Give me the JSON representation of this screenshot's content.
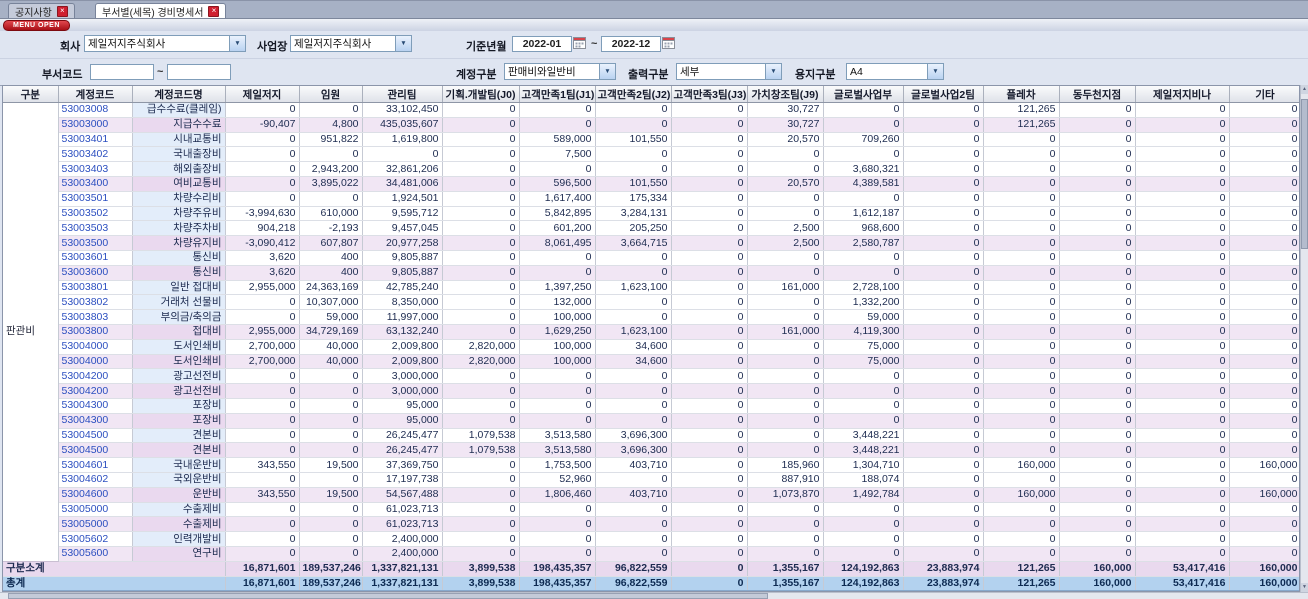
{
  "tabs": [
    {
      "label": "공지사항",
      "active": false
    },
    {
      "label": "부서별(세목) 경비명세서",
      "active": true
    }
  ],
  "menu_open_label": "MENU OPEN",
  "filters": {
    "company_label": "회사",
    "company_value": "제일저지주식회사",
    "worksite_label": "사업장",
    "worksite_value": "제일저지주식회사",
    "base_month_label": "기준년월",
    "date_from": "2022-01",
    "date_to": "2022-12",
    "tilde": "~",
    "dept_code_label": "부서코드",
    "dept_from": "",
    "dept_to": "",
    "account_type_label": "계정구분",
    "account_type_value": "판매비와일반비",
    "output_type_label": "출력구분",
    "output_type_value": "세부",
    "paper_type_label": "용지구분",
    "paper_type_value": "A4"
  },
  "colors": {
    "accent-red": "#cf2030",
    "tabbar-bg": "#a7b1c5",
    "panel-bg": "#dfe5f1",
    "detail-bg": "#ffffff",
    "detail-name-bg": "#e3edfa",
    "subtotal-bg": "#f1e6f4",
    "subtotal-name-bg": "#ead9ef",
    "groupcol-bg": "#f3e8f5",
    "grand-subtotal-bg": "#e9d9ee",
    "total-bg": "#b3d2ef",
    "code-color": "#2c4fc0",
    "num-color": "#1d2b50",
    "header-grad-top": "#fafbfc",
    "header-grad-bottom": "#dfe2e9"
  },
  "table": {
    "headers": [
      "구분",
      "계정코드",
      "계정코드명",
      "제일저지",
      "임원",
      "관리팀",
      "기획.개발팀(J0)",
      "고객만족1팀(J1)",
      "고객만족2팀(J2)",
      "고객만족3팀(J3)",
      "가치창조팀(J9)",
      "글로벌사업부",
      "글로벌사업2팀",
      "플레차",
      "동두천지점",
      "제일저지비나",
      "기타"
    ],
    "group_label": "판관비",
    "rows": [
      {
        "type": "detail",
        "code": "53003008",
        "name": "급수수료(클레임)",
        "values": [
          "0",
          "0",
          "33,102,450",
          "0",
          "0",
          "0",
          "0",
          "30,727",
          "0",
          "0",
          "121,265",
          "0",
          "0",
          "0"
        ]
      },
      {
        "type": "subtotal",
        "code": "53003000",
        "name": "지급수수료",
        "values": [
          "-90,407",
          "4,800",
          "435,035,607",
          "0",
          "0",
          "0",
          "0",
          "30,727",
          "0",
          "0",
          "121,265",
          "0",
          "0",
          "0"
        ]
      },
      {
        "type": "detail",
        "code": "53003401",
        "name": "시내교통비",
        "values": [
          "0",
          "951,822",
          "1,619,800",
          "0",
          "589,000",
          "101,550",
          "0",
          "20,570",
          "709,260",
          "0",
          "0",
          "0",
          "0",
          "0"
        ]
      },
      {
        "type": "detail",
        "code": "53003402",
        "name": "국내출장비",
        "values": [
          "0",
          "0",
          "0",
          "0",
          "7,500",
          "0",
          "0",
          "0",
          "0",
          "0",
          "0",
          "0",
          "0",
          "0"
        ]
      },
      {
        "type": "detail",
        "code": "53003403",
        "name": "해외출장비",
        "values": [
          "0",
          "2,943,200",
          "32,861,206",
          "0",
          "0",
          "0",
          "0",
          "0",
          "3,680,321",
          "0",
          "0",
          "0",
          "0",
          "0"
        ]
      },
      {
        "type": "subtotal",
        "code": "53003400",
        "name": "여비교통비",
        "values": [
          "0",
          "3,895,022",
          "34,481,006",
          "0",
          "596,500",
          "101,550",
          "0",
          "20,570",
          "4,389,581",
          "0",
          "0",
          "0",
          "0",
          "0"
        ]
      },
      {
        "type": "detail",
        "code": "53003501",
        "name": "차량수리비",
        "values": [
          "0",
          "0",
          "1,924,501",
          "0",
          "1,617,400",
          "175,334",
          "0",
          "0",
          "0",
          "0",
          "0",
          "0",
          "0",
          "0"
        ]
      },
      {
        "type": "detail",
        "code": "53003502",
        "name": "차량주유비",
        "values": [
          "-3,994,630",
          "610,000",
          "9,595,712",
          "0",
          "5,842,895",
          "3,284,131",
          "0",
          "0",
          "1,612,187",
          "0",
          "0",
          "0",
          "0",
          "0"
        ]
      },
      {
        "type": "detail",
        "code": "53003503",
        "name": "차량주차비",
        "values": [
          "904,218",
          "-2,193",
          "9,457,045",
          "0",
          "601,200",
          "205,250",
          "0",
          "2,500",
          "968,600",
          "0",
          "0",
          "0",
          "0",
          "0"
        ]
      },
      {
        "type": "subtotal",
        "code": "53003500",
        "name": "차량유지비",
        "values": [
          "-3,090,412",
          "607,807",
          "20,977,258",
          "0",
          "8,061,495",
          "3,664,715",
          "0",
          "2,500",
          "2,580,787",
          "0",
          "0",
          "0",
          "0",
          "0"
        ]
      },
      {
        "type": "detail",
        "code": "53003601",
        "name": "통신비",
        "values": [
          "3,620",
          "400",
          "9,805,887",
          "0",
          "0",
          "0",
          "0",
          "0",
          "0",
          "0",
          "0",
          "0",
          "0",
          "0"
        ]
      },
      {
        "type": "subtotal",
        "code": "53003600",
        "name": "통신비",
        "values": [
          "3,620",
          "400",
          "9,805,887",
          "0",
          "0",
          "0",
          "0",
          "0",
          "0",
          "0",
          "0",
          "0",
          "0",
          "0"
        ]
      },
      {
        "type": "detail",
        "code": "53003801",
        "name": "일반 접대비",
        "values": [
          "2,955,000",
          "24,363,169",
          "42,785,240",
          "0",
          "1,397,250",
          "1,623,100",
          "0",
          "161,000",
          "2,728,100",
          "0",
          "0",
          "0",
          "0",
          "0"
        ]
      },
      {
        "type": "detail",
        "code": "53003802",
        "name": "거래처 선물비",
        "values": [
          "0",
          "10,307,000",
          "8,350,000",
          "0",
          "132,000",
          "0",
          "0",
          "0",
          "1,332,200",
          "0",
          "0",
          "0",
          "0",
          "0"
        ]
      },
      {
        "type": "detail",
        "code": "53003803",
        "name": "부의금/축의금",
        "values": [
          "0",
          "59,000",
          "11,997,000",
          "0",
          "100,000",
          "0",
          "0",
          "0",
          "59,000",
          "0",
          "0",
          "0",
          "0",
          "0"
        ]
      },
      {
        "type": "subtotal",
        "code": "53003800",
        "name": "접대비",
        "values": [
          "2,955,000",
          "34,729,169",
          "63,132,240",
          "0",
          "1,629,250",
          "1,623,100",
          "0",
          "161,000",
          "4,119,300",
          "0",
          "0",
          "0",
          "0",
          "0"
        ]
      },
      {
        "type": "detail",
        "code": "53004000",
        "name": "도서인쇄비",
        "values": [
          "2,700,000",
          "40,000",
          "2,009,800",
          "2,820,000",
          "100,000",
          "34,600",
          "0",
          "0",
          "75,000",
          "0",
          "0",
          "0",
          "0",
          "0"
        ]
      },
      {
        "type": "subtotal",
        "code": "53004000",
        "name": "도서인쇄비",
        "values": [
          "2,700,000",
          "40,000",
          "2,009,800",
          "2,820,000",
          "100,000",
          "34,600",
          "0",
          "0",
          "75,000",
          "0",
          "0",
          "0",
          "0",
          "0"
        ]
      },
      {
        "type": "detail",
        "code": "53004200",
        "name": "광고선전비",
        "values": [
          "0",
          "0",
          "3,000,000",
          "0",
          "0",
          "0",
          "0",
          "0",
          "0",
          "0",
          "0",
          "0",
          "0",
          "0"
        ]
      },
      {
        "type": "subtotal",
        "code": "53004200",
        "name": "광고선전비",
        "values": [
          "0",
          "0",
          "3,000,000",
          "0",
          "0",
          "0",
          "0",
          "0",
          "0",
          "0",
          "0",
          "0",
          "0",
          "0"
        ]
      },
      {
        "type": "detail",
        "code": "53004300",
        "name": "포장비",
        "values": [
          "0",
          "0",
          "95,000",
          "0",
          "0",
          "0",
          "0",
          "0",
          "0",
          "0",
          "0",
          "0",
          "0",
          "0"
        ]
      },
      {
        "type": "subtotal",
        "code": "53004300",
        "name": "포장비",
        "values": [
          "0",
          "0",
          "95,000",
          "0",
          "0",
          "0",
          "0",
          "0",
          "0",
          "0",
          "0",
          "0",
          "0",
          "0"
        ]
      },
      {
        "type": "detail",
        "code": "53004500",
        "name": "견본비",
        "values": [
          "0",
          "0",
          "26,245,477",
          "1,079,538",
          "3,513,580",
          "3,696,300",
          "0",
          "0",
          "3,448,221",
          "0",
          "0",
          "0",
          "0",
          "0"
        ]
      },
      {
        "type": "subtotal",
        "code": "53004500",
        "name": "견본비",
        "values": [
          "0",
          "0",
          "26,245,477",
          "1,079,538",
          "3,513,580",
          "3,696,300",
          "0",
          "0",
          "3,448,221",
          "0",
          "0",
          "0",
          "0",
          "0"
        ]
      },
      {
        "type": "detail",
        "code": "53004601",
        "name": "국내운반비",
        "values": [
          "343,550",
          "19,500",
          "37,369,750",
          "0",
          "1,753,500",
          "403,710",
          "0",
          "185,960",
          "1,304,710",
          "0",
          "160,000",
          "0",
          "0",
          "160,000"
        ]
      },
      {
        "type": "detail",
        "code": "53004602",
        "name": "국외운반비",
        "values": [
          "0",
          "0",
          "17,197,738",
          "0",
          "52,960",
          "0",
          "0",
          "887,910",
          "188,074",
          "0",
          "0",
          "0",
          "0",
          "0"
        ]
      },
      {
        "type": "subtotal",
        "code": "53004600",
        "name": "운반비",
        "values": [
          "343,550",
          "19,500",
          "54,567,488",
          "0",
          "1,806,460",
          "403,710",
          "0",
          "1,073,870",
          "1,492,784",
          "0",
          "160,000",
          "0",
          "0",
          "160,000"
        ]
      },
      {
        "type": "detail",
        "code": "53005000",
        "name": "수출제비",
        "values": [
          "0",
          "0",
          "61,023,713",
          "0",
          "0",
          "0",
          "0",
          "0",
          "0",
          "0",
          "0",
          "0",
          "0",
          "0"
        ]
      },
      {
        "type": "subtotal",
        "code": "53005000",
        "name": "수출제비",
        "values": [
          "0",
          "0",
          "61,023,713",
          "0",
          "0",
          "0",
          "0",
          "0",
          "0",
          "0",
          "0",
          "0",
          "0",
          "0"
        ]
      },
      {
        "type": "detail",
        "code": "53005602",
        "name": "인력개발비",
        "values": [
          "0",
          "0",
          "2,400,000",
          "0",
          "0",
          "0",
          "0",
          "0",
          "0",
          "0",
          "0",
          "0",
          "0",
          "0"
        ]
      },
      {
        "type": "subtotal",
        "code": "53005600",
        "name": "연구비",
        "values": [
          "0",
          "0",
          "2,400,000",
          "0",
          "0",
          "0",
          "0",
          "0",
          "0",
          "0",
          "0",
          "0",
          "0",
          "0"
        ]
      }
    ],
    "footer": [
      {
        "type": "grandsub",
        "label": "구분소계",
        "values": [
          "16,871,601",
          "189,537,246",
          "1,337,821,131",
          "3,899,538",
          "198,435,357",
          "96,822,559",
          "0",
          "1,355,167",
          "124,192,863",
          "23,883,974",
          "121,265",
          "160,000",
          "53,417,416",
          "160,000"
        ]
      },
      {
        "type": "total",
        "label": "총계",
        "values": [
          "16,871,601",
          "189,537,246",
          "1,337,821,131",
          "3,899,538",
          "198,435,357",
          "96,822,559",
          "0",
          "1,355,167",
          "124,192,863",
          "23,883,974",
          "121,265",
          "160,000",
          "53,417,416",
          "160,000"
        ]
      }
    ]
  }
}
